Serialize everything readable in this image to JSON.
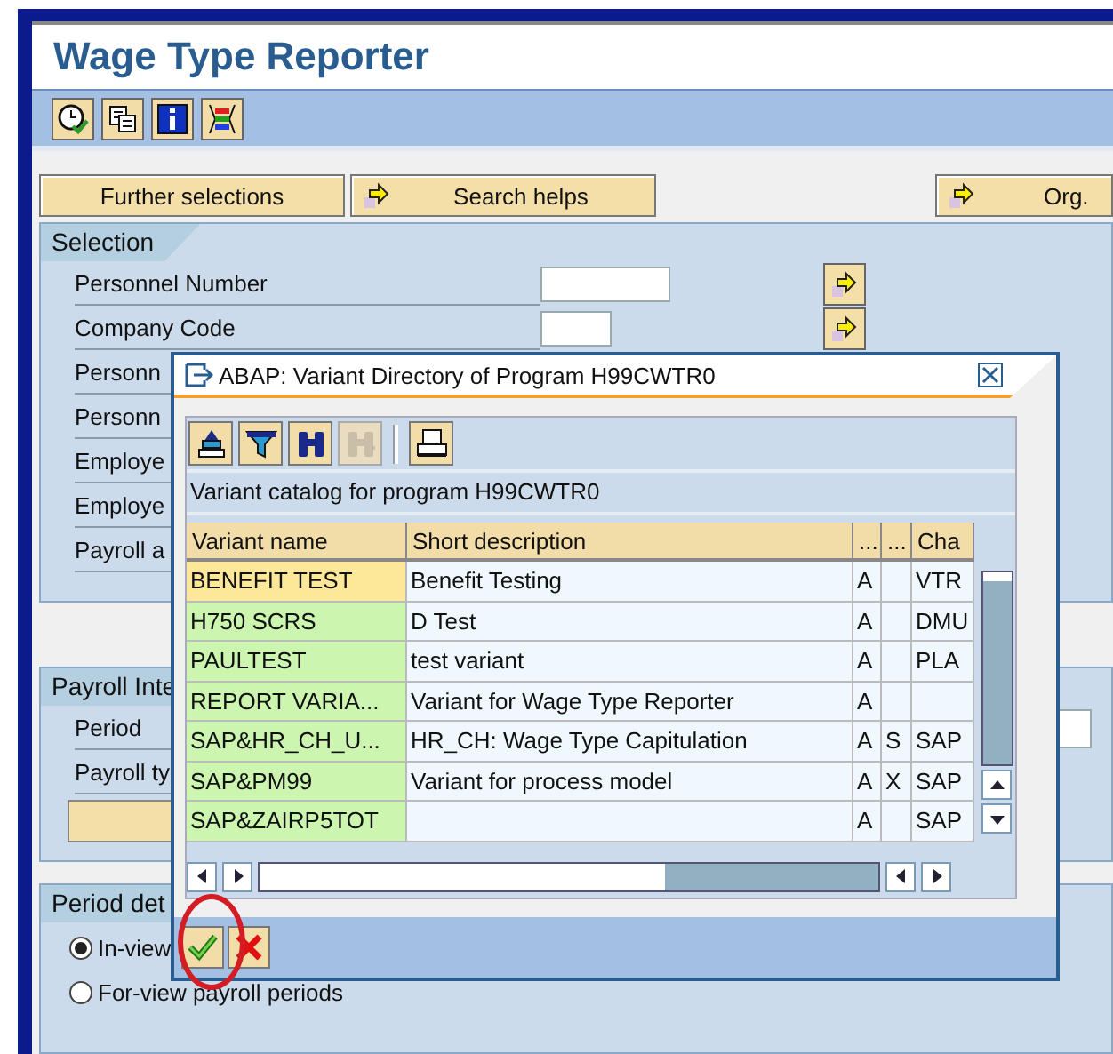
{
  "window": {
    "title": "Wage Type Reporter"
  },
  "toolbar": [
    {
      "kind": "clock"
    },
    {
      "kind": "copy"
    },
    {
      "kind": "info"
    },
    {
      "kind": "layout"
    }
  ],
  "buttons": [
    {
      "label": "Further selections",
      "kind": "plain"
    },
    {
      "label": "Search helps",
      "kind": "arrow"
    },
    {
      "label": "Org.",
      "kind": "arrow"
    }
  ],
  "selection": {
    "title": "Selection",
    "rows": [
      {
        "label": "Personnel Number",
        "kind": "field"
      },
      {
        "label": "Company Code",
        "kind": "field"
      },
      {
        "label": "Personn",
        "kind": "label"
      },
      {
        "label": "Personn",
        "kind": "label"
      },
      {
        "label": "Employe",
        "kind": "label"
      },
      {
        "label": "Employe",
        "kind": "label"
      },
      {
        "label": "Payroll a",
        "kind": "label"
      }
    ]
  },
  "payroll": {
    "title": "Payroll Inte",
    "rows": [
      {
        "label": "Period",
        "kind": "field"
      },
      {
        "label": "Payroll ty",
        "kind": "label"
      }
    ]
  },
  "period": {
    "title": "Period det",
    "options": [
      {
        "label": "In-view",
        "selected": true
      },
      {
        "label": "For-view payroll periods",
        "selected": false
      }
    ]
  },
  "dialog": {
    "title": "ABAP: Variant Directory of Program H99CWTR0",
    "toolbar": [
      {
        "kind": "sort",
        "disabled": false
      },
      {
        "kind": "filter",
        "disabled": false
      },
      {
        "kind": "find",
        "disabled": false
      },
      {
        "kind": "find-next",
        "disabled": true
      },
      {
        "kind": "print",
        "disabled": false
      }
    ],
    "caption": "Variant catalog for program H99CWTR0",
    "columns": [
      "Variant name",
      "Short description",
      "...",
      "...",
      "Cha"
    ],
    "rows": [
      {
        "cells": [
          "BENEFIT TEST",
          "Benefit Testing",
          "A",
          "",
          "VTR"
        ],
        "selected": true
      },
      {
        "cells": [
          "H750 SCRS",
          "D Test",
          "A",
          "",
          "DMU"
        ],
        "selected": false
      },
      {
        "cells": [
          "PAULTEST",
          "test variant",
          "A",
          "",
          "PLA"
        ],
        "selected": false
      },
      {
        "cells": [
          "REPORT VARIA...",
          "Variant for Wage Type Reporter",
          "A",
          "",
          ""
        ],
        "selected": false
      },
      {
        "cells": [
          "SAP&HR_CH_U...",
          "HR_CH: Wage Type Capitulation",
          "A",
          "S",
          "SAP"
        ],
        "selected": false
      },
      {
        "cells": [
          "SAP&PM99",
          "Variant for process model",
          "A",
          "X",
          "SAP"
        ],
        "selected": false
      },
      {
        "cells": [
          "SAP&ZAIRP5TOT",
          "",
          "A",
          "",
          "SAP"
        ],
        "selected": false
      }
    ],
    "actions": [
      {
        "kind": "confirm"
      },
      {
        "kind": "cancel"
      }
    ]
  }
}
